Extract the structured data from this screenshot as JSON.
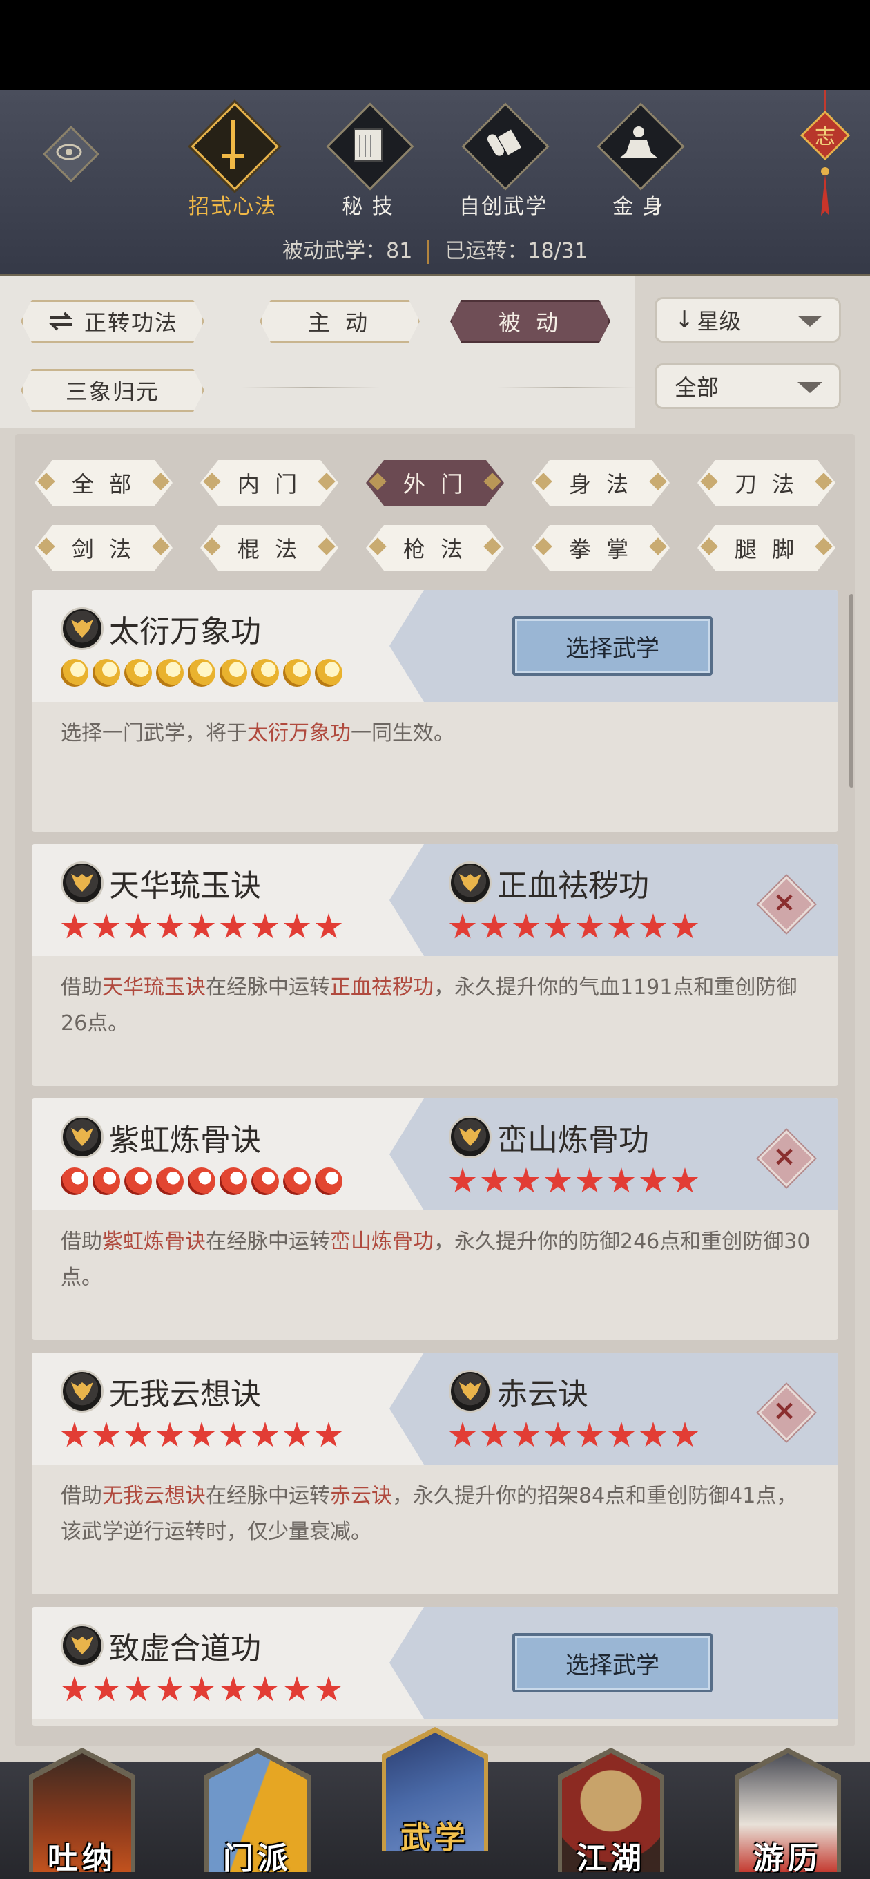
{
  "header": {
    "eye_icon": "eye-icon",
    "charm_icon": "knot-charm-icon",
    "charm_char": "志",
    "categories": [
      {
        "label": "招式心法",
        "icon": "sword-icon",
        "active": true
      },
      {
        "label": "秘 技",
        "icon": "book-icon",
        "active": false
      },
      {
        "label": "自创武学",
        "icon": "scroll-icon",
        "active": false
      },
      {
        "label": "金 身",
        "icon": "meditation-icon",
        "active": false
      }
    ],
    "stats": {
      "passive_label": "被动武学：81",
      "running_label": "已运转：18/31"
    }
  },
  "filters": {
    "mode_button": "正转功法",
    "active_button": "主 动",
    "passive_button": "被 动",
    "sort_dropdown": "星级",
    "sanxiang_button": "三象归元",
    "type_dropdown": "全部"
  },
  "tags": [
    "全 部",
    "内 门",
    "外 门",
    "身 法",
    "刀 法",
    "剑 法",
    "棍 法",
    "枪 法",
    "拳 掌",
    "腿 脚"
  ],
  "selected_tag": "外 门",
  "cards": [
    {
      "left_name": "太衍万象功",
      "left_rank": "moon",
      "left_rank_count": 9,
      "right_type": "select",
      "select_label": "选择武学",
      "desc": [
        {
          "t": "选择一门武学，将于"
        },
        {
          "t": "太衍万象功",
          "hl": true
        },
        {
          "t": "一同生效。"
        }
      ]
    },
    {
      "left_name": "天华琉玉诀",
      "left_rank": "star",
      "left_rank_count": 9,
      "right_name": "正血祛秽功",
      "right_rank": "star",
      "right_rank_count": 8,
      "right_type": "slot",
      "desc": [
        {
          "t": "借助"
        },
        {
          "t": "天华琉玉诀",
          "hl": true
        },
        {
          "t": "在经脉中运转"
        },
        {
          "t": "正血祛秽功",
          "hl": true
        },
        {
          "t": "，永久提升你的气血1191点和重创防御26点。"
        }
      ]
    },
    {
      "left_name": "紫虹炼骨诀",
      "left_rank": "flame",
      "left_rank_count": 9,
      "right_name": "峦山炼骨功",
      "right_rank": "star",
      "right_rank_count": 8,
      "right_type": "slot",
      "desc": [
        {
          "t": "借助"
        },
        {
          "t": "紫虹炼骨诀",
          "hl": true
        },
        {
          "t": "在经脉中运转"
        },
        {
          "t": "峦山炼骨功",
          "hl": true
        },
        {
          "t": "，永久提升你的防御246点和重创防御30点。"
        }
      ]
    },
    {
      "left_name": "无我云想诀",
      "left_rank": "star",
      "left_rank_count": 9,
      "right_name": "赤云诀",
      "right_rank": "star",
      "right_rank_count": 8,
      "right_type": "slot",
      "desc": [
        {
          "t": "借助"
        },
        {
          "t": "无我云想诀",
          "hl": true
        },
        {
          "t": "在经脉中运转"
        },
        {
          "t": "赤云诀",
          "hl": true
        },
        {
          "t": "，永久提升你的招架84点和重创防御41点，该武学逆行运转时，仅少量衰减。"
        }
      ]
    },
    {
      "left_name": "致虚合道功",
      "left_rank": "star",
      "left_rank_count": 9,
      "right_type": "select",
      "select_label": "选择武学",
      "desc": []
    }
  ],
  "remove_symbol": "×",
  "nav": [
    {
      "label": "吐纳",
      "icon": "monk-icon",
      "active": false
    },
    {
      "label": "门派",
      "icon": "sect-flags-icon",
      "active": false
    },
    {
      "label": "武学",
      "icon": "manual-book-icon",
      "active": true
    },
    {
      "label": "江湖",
      "icon": "straw-hat-icon",
      "active": false
    },
    {
      "label": "游历",
      "icon": "horse-icon",
      "active": false
    }
  ],
  "colors": {
    "active_gold": "#f0b846",
    "highlight_red": "#b04a3e",
    "selected_tag": "#6b4a52",
    "star_red": "#e23d35"
  }
}
